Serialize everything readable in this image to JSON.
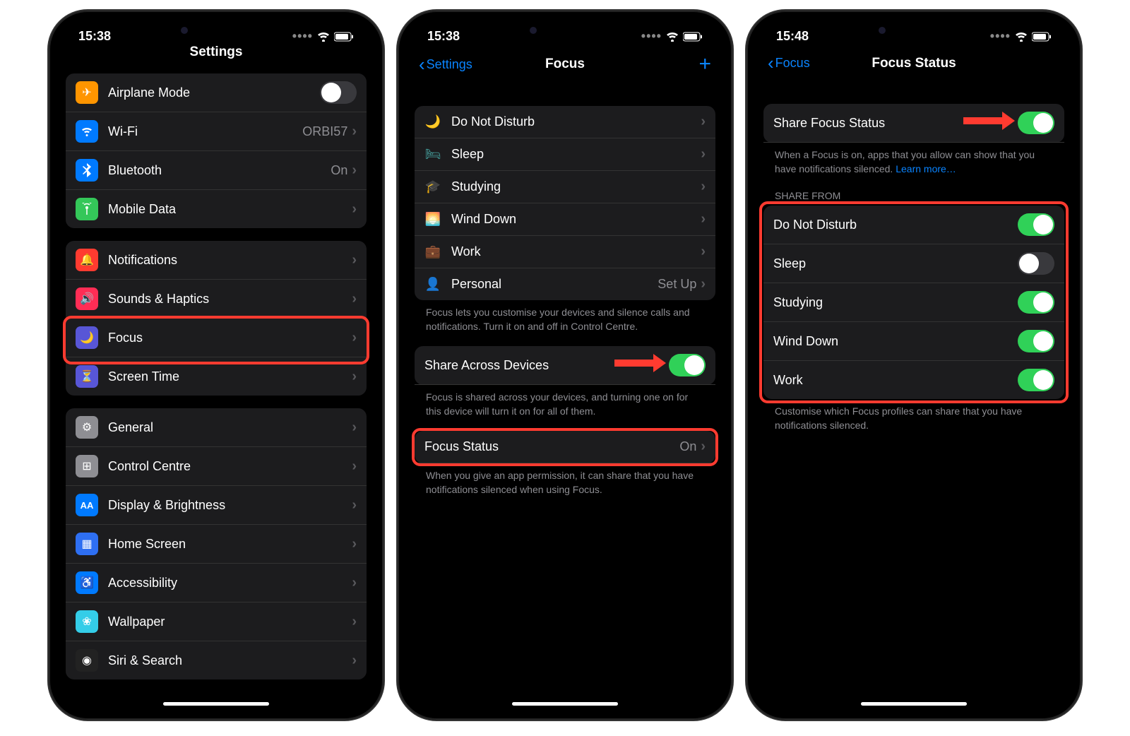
{
  "p1": {
    "time": "15:38",
    "title": "Settings",
    "g1": [
      {
        "icon": "✈︎",
        "bg": "#ff9500",
        "label": "Airplane Mode",
        "toggle": "off"
      },
      {
        "icon": "wifi",
        "bg": "#007aff",
        "label": "Wi-Fi",
        "detail": "ORBI57"
      },
      {
        "icon": "bt",
        "bg": "#007aff",
        "label": "Bluetooth",
        "detail": "On"
      },
      {
        "icon": "ant",
        "bg": "#34c759",
        "label": "Mobile Data"
      }
    ],
    "g2": [
      {
        "icon": "🔔",
        "bg": "#ff3b30",
        "label": "Notifications"
      },
      {
        "icon": "🔊",
        "bg": "#ff2d55",
        "label": "Sounds & Haptics"
      },
      {
        "icon": "🌙",
        "bg": "#5856d6",
        "label": "Focus"
      },
      {
        "icon": "⏳",
        "bg": "#5856d6",
        "label": "Screen Time"
      }
    ],
    "g3": [
      {
        "icon": "⚙",
        "bg": "#8e8e93",
        "label": "General"
      },
      {
        "icon": "⊞",
        "bg": "#8e8e93",
        "label": "Control Centre"
      },
      {
        "icon": "AA",
        "bg": "#007aff",
        "label": "Display & Brightness"
      },
      {
        "icon": "▦",
        "bg": "#2e6ff2",
        "label": "Home Screen"
      },
      {
        "icon": "♿",
        "bg": "#007aff",
        "label": "Accessibility"
      },
      {
        "icon": "❀",
        "bg": "#34cde8",
        "label": "Wallpaper"
      },
      {
        "icon": "◉",
        "bg": "#222",
        "label": "Siri & Search"
      }
    ]
  },
  "p2": {
    "time": "15:38",
    "back": "Settings",
    "title": "Focus",
    "modes": [
      {
        "icon": "🌙",
        "color": "#5e5ce6",
        "label": "Do Not Disturb"
      },
      {
        "icon": "🛏",
        "color": "#48a9a6",
        "label": "Sleep"
      },
      {
        "icon": "🎓",
        "color": "#ff9500",
        "label": "Studying"
      },
      {
        "icon": "🌅",
        "color": "#ff9500",
        "label": "Wind Down"
      },
      {
        "icon": "💼",
        "color": "#5ac8fa",
        "label": "Work"
      },
      {
        "icon": "👤",
        "color": "#af52de",
        "label": "Personal",
        "detail": "Set Up"
      }
    ],
    "foot1": "Focus lets you customise your devices and silence calls and notifications. Turn it on and off in Control Centre.",
    "share": {
      "label": "Share Across Devices",
      "on": true
    },
    "foot2": "Focus is shared across your devices, and turning one on for this device will turn it on for all of them.",
    "status": {
      "label": "Focus Status",
      "detail": "On"
    },
    "foot3": "When you give an app permission, it can share that you have notifications silenced when using Focus."
  },
  "p3": {
    "time": "15:48",
    "back": "Focus",
    "title": "Focus Status",
    "share": {
      "label": "Share Focus Status",
      "on": true
    },
    "foot1": "When a Focus is on, apps that you allow can show that you have notifications silenced. ",
    "learn": "Learn more…",
    "header": "SHARE FROM",
    "items": [
      {
        "label": "Do Not Disturb",
        "on": true
      },
      {
        "label": "Sleep",
        "on": false
      },
      {
        "label": "Studying",
        "on": true
      },
      {
        "label": "Wind Down",
        "on": true
      },
      {
        "label": "Work",
        "on": true
      }
    ],
    "foot2": "Customise which Focus profiles can share that you have notifications silenced."
  }
}
